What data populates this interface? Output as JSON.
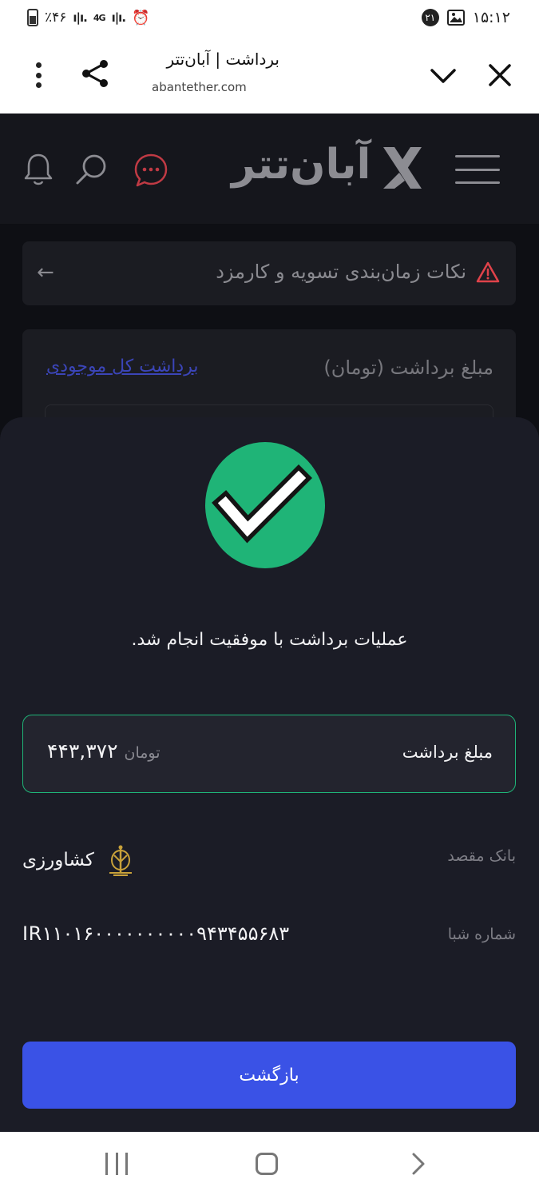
{
  "status_bar": {
    "time": "۱۵:۱۲",
    "battery": "٪۴۶",
    "network": "4G",
    "notification_count": "۲۱"
  },
  "browser": {
    "title": "برداشت | آبان‌تتر",
    "url": "abantether.com"
  },
  "app_header": {
    "logo_text": "آبان‌تتر"
  },
  "notice": {
    "text": "نکات زمان‌بندی تسویه و کارمزد"
  },
  "withdraw_form": {
    "amount_label": "مبلغ برداشت (تومان)",
    "withdraw_all_link": "برداشت کل موجودی"
  },
  "result": {
    "message": "عملیات برداشت با موفقیت انجام شد.",
    "amount_label": "مبلغ برداشت",
    "amount_value": "۴۴۳,۳۷۲",
    "amount_unit": "تومان",
    "bank_label": "بانک مقصد",
    "bank_name": "کشاورزی",
    "sheba_label": "شماره شبا",
    "sheba_value": "IR۱۱۰۱۶۰۰۰۰۰۰۰۰۰۰۹۴۳۴۵۵۶۸۳",
    "back_button": "بازگشت"
  },
  "colors": {
    "success": "#1fb477",
    "primary_button": "#3a52e6",
    "warning": "#e0424a",
    "link": "#3b45b8"
  }
}
